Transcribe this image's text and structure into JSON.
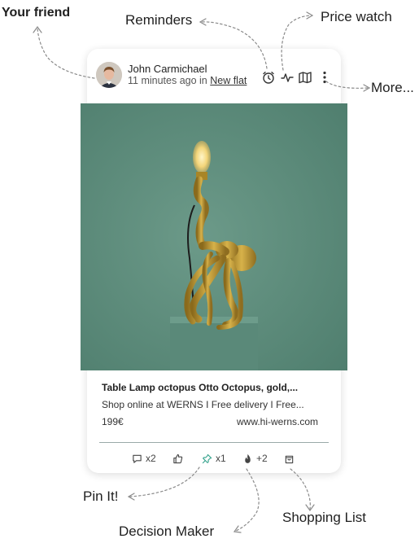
{
  "callouts": {
    "friend": "Your friend",
    "reminders": "Reminders",
    "price_watch": "Price watch",
    "more": "More...",
    "pin_it": "Pin It!",
    "decision_maker": "Decision Maker",
    "shopping_list": "Shopping List"
  },
  "post": {
    "author": "John Carmichael",
    "time_prefix": "11 minutes ago in ",
    "board": "New flat"
  },
  "product": {
    "title": "Table Lamp octopus Otto Octopus, gold,...",
    "description": "Shop online at WERNS I Free delivery I Free...",
    "price": "199€",
    "site": "www.hi-werns.com"
  },
  "actions": {
    "comments": "x2",
    "pins": "x1",
    "fire": "+2"
  },
  "colors": {
    "photo_background": "#5e8e7d",
    "lamp_gold": "#b8942f",
    "pin_accent": "#3aa58f"
  }
}
